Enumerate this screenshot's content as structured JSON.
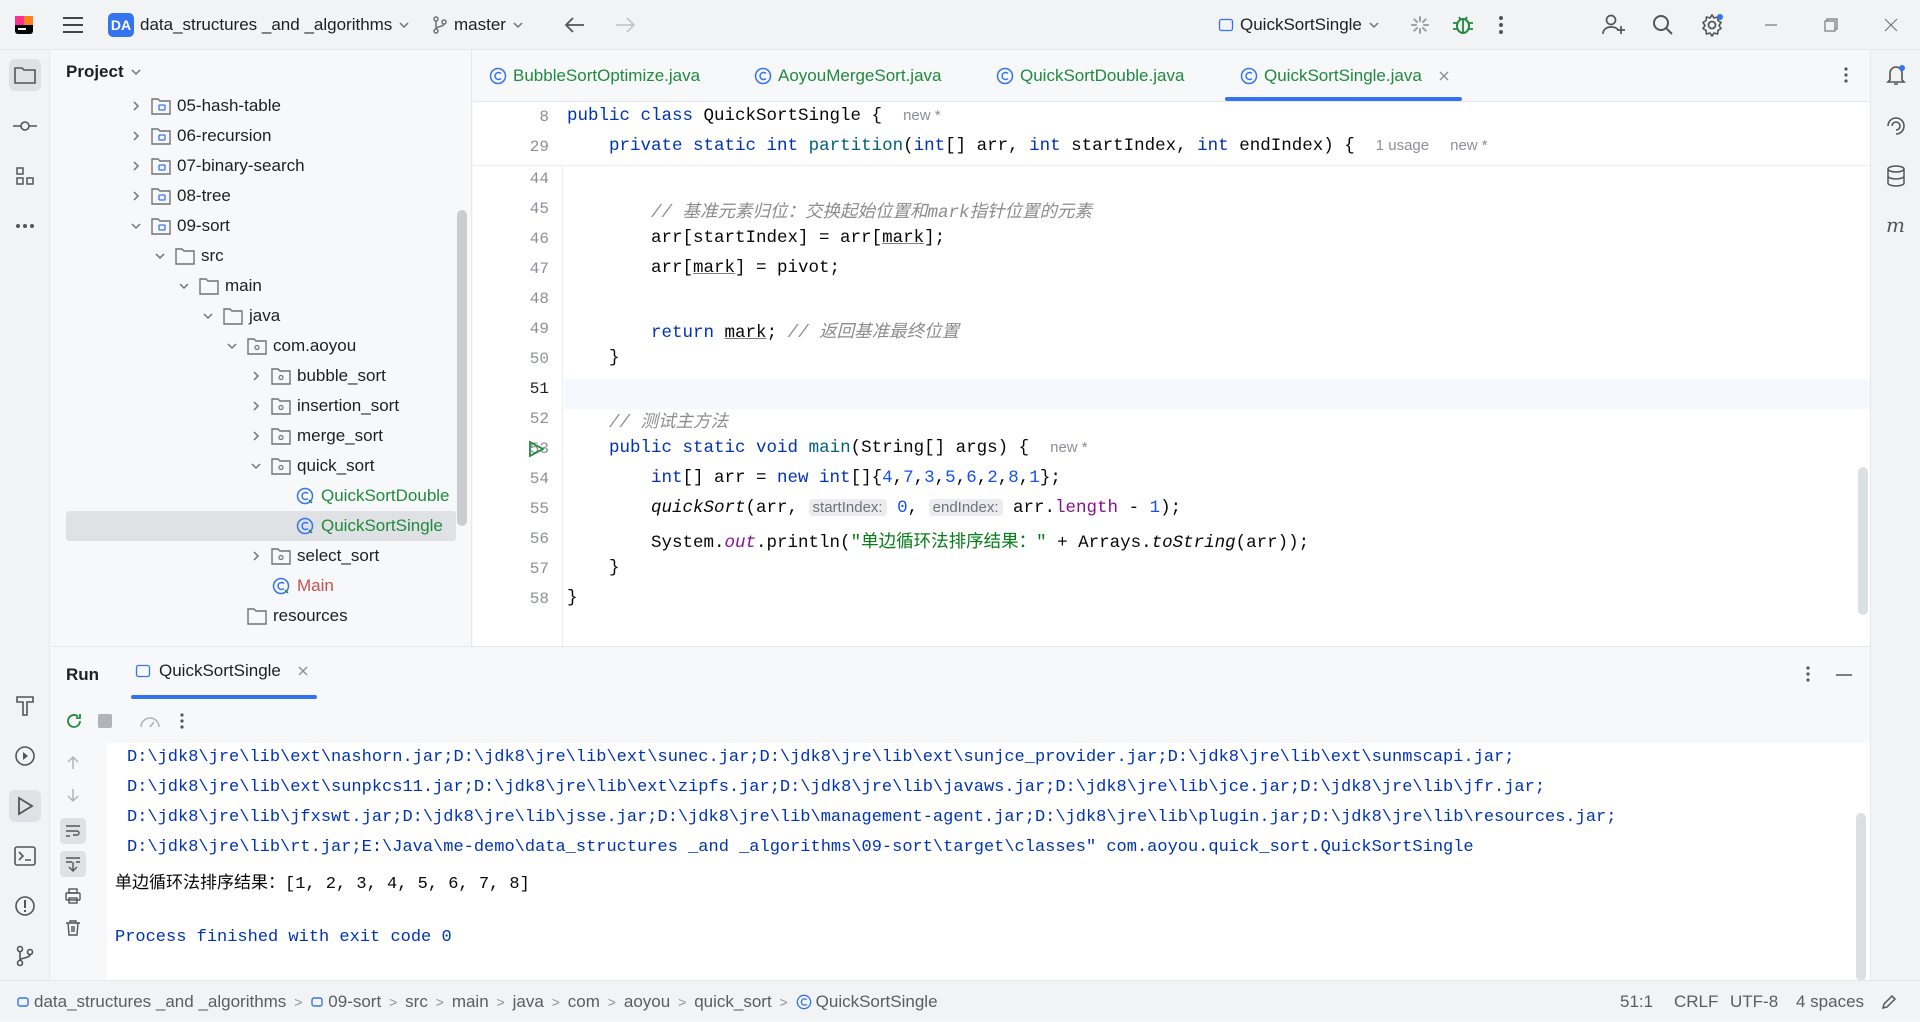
{
  "titlebar": {
    "project_badge": "DA",
    "project_name": "data_structures _and _algorithms",
    "branch": "master",
    "run_config": "QuickSortSingle"
  },
  "project_panel": {
    "title": "Project",
    "tree": [
      {
        "label": "05-hash-table",
        "type": "module"
      },
      {
        "label": "06-recursion",
        "type": "module"
      },
      {
        "label": "07-binary-search",
        "type": "module"
      },
      {
        "label": "08-tree",
        "type": "module"
      },
      {
        "label": "09-sort",
        "type": "module"
      },
      {
        "label": "src",
        "type": "folder"
      },
      {
        "label": "main",
        "type": "folder"
      },
      {
        "label": "java",
        "type": "folder"
      },
      {
        "label": "com.aoyou",
        "type": "package"
      },
      {
        "label": "bubble_sort",
        "type": "package"
      },
      {
        "label": "insertion_sort",
        "type": "package"
      },
      {
        "label": "merge_sort",
        "type": "package"
      },
      {
        "label": "quick_sort",
        "type": "package"
      },
      {
        "label": "QuickSortDouble",
        "type": "class"
      },
      {
        "label": "QuickSortSingle",
        "type": "class"
      },
      {
        "label": "select_sort",
        "type": "package"
      },
      {
        "label": "Main",
        "type": "class"
      },
      {
        "label": "resources",
        "type": "folder"
      }
    ]
  },
  "tabs": [
    {
      "label": "BubbleSortOptimize.java"
    },
    {
      "label": "AoyouMergeSort.java"
    },
    {
      "label": "QuickSortDouble.java"
    },
    {
      "label": "QuickSortSingle.java"
    }
  ],
  "editor": {
    "sticky": [
      {
        "line": "8",
        "hint": "new *"
      },
      {
        "line": "29",
        "usage": "1 usage",
        "hint": "new *"
      }
    ],
    "line_numbers": [
      "44",
      "45",
      "46",
      "47",
      "48",
      "49",
      "50",
      "51",
      "52",
      "53",
      "54",
      "55",
      "56",
      "57",
      "58"
    ],
    "comment_45": "// 基准元素归位：交换起始位置和mark指针位置的元素",
    "comment_49": "// 返回基准最终位置",
    "comment_52": "// 测试主方法",
    "main_hint": "new *",
    "param_hint_1": "startIndex:",
    "param_hint_2": "endIndex:",
    "string_56": "\"单边循环法排序结果：\""
  },
  "run_panel": {
    "title": "Run",
    "tab_label": "QuickSortSingle",
    "console_lines": [
      "D:\\jdk8\\jre\\lib\\ext\\nashorn.jar;D:\\jdk8\\jre\\lib\\ext\\sunec.jar;D:\\jdk8\\jre\\lib\\ext\\sunjce_provider.jar;D:\\jdk8\\jre\\lib\\ext\\sunmscapi.jar;",
      "D:\\jdk8\\jre\\lib\\ext\\sunpkcs11.jar;D:\\jdk8\\jre\\lib\\ext\\zipfs.jar;D:\\jdk8\\jre\\lib\\javaws.jar;D:\\jdk8\\jre\\lib\\jce.jar;D:\\jdk8\\jre\\lib\\jfr.jar;",
      "D:\\jdk8\\jre\\lib\\jfxswt.jar;D:\\jdk8\\jre\\lib\\jsse.jar;D:\\jdk8\\jre\\lib\\management-agent.jar;D:\\jdk8\\jre\\lib\\plugin.jar;D:\\jdk8\\jre\\lib\\resources.jar;",
      "D:\\jdk8\\jre\\lib\\rt.jar;E:\\Java\\me-demo\\data_structures _and _algorithms\\09-sort\\target\\classes\" com.aoyou.quick_sort.QuickSortSingle"
    ],
    "result_line": "单边循环法排序结果：[1, 2, 3, 4, 5, 6, 7, 8]",
    "exit_line": "Process finished with exit code 0"
  },
  "statusbar": {
    "breadcrumb": [
      "data_structures _and _algorithms",
      "09-sort",
      "src",
      "main",
      "java",
      "com",
      "aoyou",
      "quick_sort",
      "QuickSortSingle"
    ],
    "position": "51:1",
    "line_sep": "CRLF",
    "encoding": "UTF-8",
    "indent": "4 spaces"
  },
  "colors": {
    "accent": "#3574f0",
    "class_green": "#208a3c",
    "keyword": "#0033b3"
  }
}
